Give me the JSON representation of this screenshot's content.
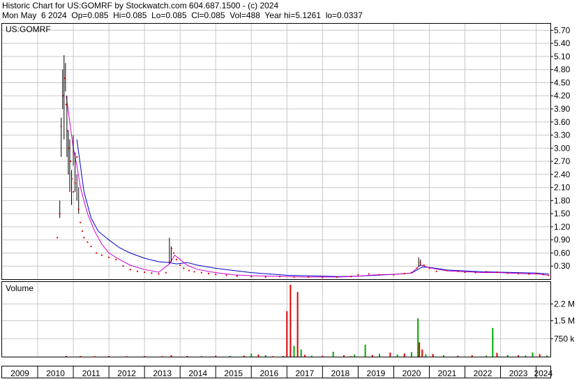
{
  "header": {
    "line1": "Historic Chart for US:GOMRF by Stockwatch.com 604.687.1500 - (c) 2024",
    "line2": "Mon May  6 2024  Op=0.085  Hi=0.085  Lo=0.085  Cl=0.085  Vol=488  Year hi=5.1261  lo=0.0337"
  },
  "colors": {
    "price_bar": "#000000",
    "close_dot": "#dd0000",
    "ma_short": "#cc00cc",
    "ma_long": "#0000cc",
    "volume_up": "#00aa00",
    "volume_down": "#dd0000",
    "grid": "#c8c8c8"
  },
  "chart_data": [
    {
      "type": "line",
      "title": "US:GOMRF",
      "ylim": [
        0,
        5.85
      ],
      "xlim": [
        2009.0,
        2024.4
      ],
      "y_ticks": [
        "0.30",
        "0.60",
        "0.90",
        "1.20",
        "1.50",
        "1.80",
        "2.10",
        "2.40",
        "2.70",
        "3.00",
        "3.30",
        "3.60",
        "3.90",
        "4.20",
        "4.50",
        "4.80",
        "5.10",
        "5.40",
        "5.70"
      ],
      "x_ticks": [
        "2009",
        "2010",
        "2011",
        "2012",
        "2013",
        "2014",
        "2015",
        "2016",
        "2017",
        "2018",
        "2019",
        "2020",
        "2021",
        "2022",
        "2023",
        "2024"
      ],
      "grid": true,
      "price_bars": {
        "x": [
          2010.62,
          2010.66,
          2010.7,
          2010.74,
          2010.78,
          2010.82,
          2010.86,
          2010.9,
          2010.95,
          2011.0,
          2011.05,
          2011.1,
          2011.15,
          2013.7,
          2013.75,
          2020.7,
          2020.75
        ],
        "low": [
          1.4,
          2.8,
          3.9,
          3.2,
          4.3,
          2.8,
          2.4,
          2.0,
          1.7,
          2.6,
          2.0,
          1.8,
          1.5,
          0.35,
          0.4,
          0.28,
          0.3
        ],
        "high": [
          1.8,
          3.7,
          4.8,
          5.13,
          4.95,
          4.2,
          3.4,
          3.2,
          2.5,
          3.3,
          2.9,
          2.4,
          2.1,
          0.95,
          0.75,
          0.5,
          0.45
        ]
      },
      "close": {
        "x": [
          2010.55,
          2010.62,
          2010.66,
          2010.72,
          2010.76,
          2010.8,
          2010.84,
          2010.88,
          2010.92,
          2010.96,
          2011.0,
          2011.05,
          2011.1,
          2011.15,
          2011.2,
          2011.25,
          2011.3,
          2011.4,
          2011.5,
          2011.65,
          2011.8,
          2012.0,
          2012.2,
          2012.4,
          2012.6,
          2012.8,
          2013.0,
          2013.2,
          2013.4,
          2013.6,
          2013.7,
          2013.76,
          2013.82,
          2013.9,
          2014.0,
          2014.1,
          2014.25,
          2014.4,
          2014.6,
          2014.8,
          2015.0,
          2015.3,
          2015.6,
          2016.0,
          2016.4,
          2016.8,
          2017.2,
          2017.6,
          2018.0,
          2018.4,
          2018.8,
          2019.0,
          2019.3,
          2019.6,
          2020.0,
          2020.3,
          2020.5,
          2020.65,
          2020.75,
          2020.85,
          2021.0,
          2021.2,
          2021.5,
          2021.8,
          2022.0,
          2022.3,
          2022.6,
          2022.9,
          2023.2,
          2023.5,
          2023.8,
          2024.0,
          2024.2,
          2024.35
        ],
        "y": [
          0.95,
          1.5,
          3.5,
          4.2,
          4.6,
          4.0,
          3.4,
          3.0,
          2.7,
          2.3,
          2.0,
          2.2,
          2.8,
          1.6,
          1.3,
          1.1,
          0.95,
          0.85,
          0.75,
          0.6,
          0.55,
          0.5,
          0.45,
          0.3,
          0.22,
          0.18,
          0.16,
          0.14,
          0.12,
          0.15,
          0.4,
          0.7,
          0.6,
          0.45,
          0.32,
          0.25,
          0.2,
          0.17,
          0.15,
          0.13,
          0.11,
          0.09,
          0.07,
          0.06,
          0.05,
          0.06,
          0.05,
          0.05,
          0.04,
          0.05,
          0.06,
          0.1,
          0.12,
          0.1,
          0.1,
          0.13,
          0.15,
          0.25,
          0.38,
          0.32,
          0.25,
          0.18,
          0.2,
          0.18,
          0.16,
          0.15,
          0.17,
          0.16,
          0.14,
          0.13,
          0.12,
          0.13,
          0.11,
          0.09
        ]
      },
      "series": [
        {
          "x": [
            2010.8,
            2010.9,
            2011.0,
            2011.1,
            2011.2,
            2011.4,
            2011.6,
            2011.8,
            2012.0,
            2012.3,
            2012.6,
            2013.0,
            2013.4,
            2013.7,
            2013.85,
            2014.0,
            2014.2,
            2014.5,
            2015.0,
            2015.5,
            2016.0,
            2016.5,
            2017.0,
            2017.5,
            2018.0,
            2018.5,
            2019.0,
            2019.5,
            2020.0,
            2020.5,
            2020.75,
            2021.0,
            2021.5,
            2022.0,
            2022.5,
            2023.0,
            2023.5,
            2024.0,
            2024.35
          ],
          "y": [
            4.2,
            3.6,
            3.0,
            2.6,
            2.1,
            1.5,
            1.1,
            0.8,
            0.6,
            0.45,
            0.32,
            0.22,
            0.16,
            0.35,
            0.55,
            0.45,
            0.32,
            0.22,
            0.15,
            0.1,
            0.08,
            0.07,
            0.06,
            0.05,
            0.05,
            0.05,
            0.07,
            0.1,
            0.11,
            0.14,
            0.33,
            0.26,
            0.19,
            0.17,
            0.15,
            0.15,
            0.13,
            0.12,
            0.09
          ]
        },
        {
          "x": [
            2011.1,
            2011.2,
            2011.3,
            2011.5,
            2011.7,
            2012.0,
            2012.3,
            2012.6,
            2013.0,
            2013.4,
            2013.7,
            2013.9,
            2014.2,
            2014.5,
            2015.0,
            2015.5,
            2016.0,
            2016.5,
            2017.0,
            2017.5,
            2018.0,
            2018.5,
            2019.0,
            2019.5,
            2020.0,
            2020.5,
            2020.8,
            2021.0,
            2021.5,
            2022.0,
            2022.5,
            2023.0,
            2023.5,
            2024.0,
            2024.35
          ],
          "y": [
            3.2,
            2.6,
            2.0,
            1.4,
            1.1,
            0.9,
            0.72,
            0.6,
            0.48,
            0.4,
            0.38,
            0.35,
            0.38,
            0.32,
            0.25,
            0.2,
            0.15,
            0.12,
            0.09,
            0.08,
            0.07,
            0.06,
            0.07,
            0.09,
            0.11,
            0.14,
            0.28,
            0.27,
            0.21,
            0.19,
            0.17,
            0.16,
            0.15,
            0.14,
            0.12
          ]
        }
      ]
    },
    {
      "type": "bar",
      "title": "Volume",
      "ylim": [
        0,
        3000000
      ],
      "y_ticks": [
        "750 k",
        "1.5 M",
        "2.2 M"
      ],
      "bars": {
        "x": [
          2010.8,
          2011.2,
          2011.6,
          2012.0,
          2012.5,
          2013.0,
          2013.5,
          2013.75,
          2014.2,
          2014.6,
          2015.0,
          2015.4,
          2015.8,
          2016.0,
          2016.2,
          2016.4,
          2016.6,
          2016.9,
          2017.0,
          2017.1,
          2017.2,
          2017.3,
          2017.4,
          2017.5,
          2017.7,
          2018.0,
          2018.3,
          2018.6,
          2018.8,
          2018.9,
          2019.2,
          2019.4,
          2019.6,
          2019.9,
          2020.1,
          2020.3,
          2020.5,
          2020.68,
          2020.72,
          2020.8,
          2020.9,
          2021.1,
          2021.4,
          2021.8,
          2022.2,
          2022.6,
          2022.78,
          2022.9,
          2023.2,
          2023.5,
          2023.7,
          2023.9,
          2024.1,
          2024.3
        ],
        "volume": [
          30000,
          25000,
          20000,
          30000,
          20000,
          25000,
          20000,
          60000,
          30000,
          20000,
          40000,
          30000,
          40000,
          130000,
          90000,
          60000,
          20000,
          30000,
          1900000,
          3000000,
          450000,
          2700000,
          300000,
          80000,
          40000,
          40000,
          200000,
          60000,
          20000,
          90000,
          500000,
          70000,
          120000,
          170000,
          90000,
          130000,
          190000,
          1600000,
          600000,
          300000,
          100000,
          110000,
          60000,
          40000,
          60000,
          50000,
          1200000,
          160000,
          70000,
          60000,
          50000,
          180000,
          110000,
          50000
        ],
        "direction": [
          "down",
          "down",
          "down",
          "down",
          "down",
          "down",
          "down",
          "down",
          "down",
          "down",
          "down",
          "up",
          "down",
          "up",
          "down",
          "up",
          "down",
          "down",
          "down",
          "down",
          "up",
          "down",
          "up",
          "down",
          "up",
          "down",
          "up",
          "down",
          "down",
          "up",
          "up",
          "down",
          "up",
          "down",
          "up",
          "down",
          "up",
          "up",
          "down",
          "down",
          "up",
          "down",
          "up",
          "down",
          "down",
          "up",
          "up",
          "down",
          "up",
          "down",
          "up",
          "up",
          "down",
          "up"
        ]
      }
    }
  ]
}
